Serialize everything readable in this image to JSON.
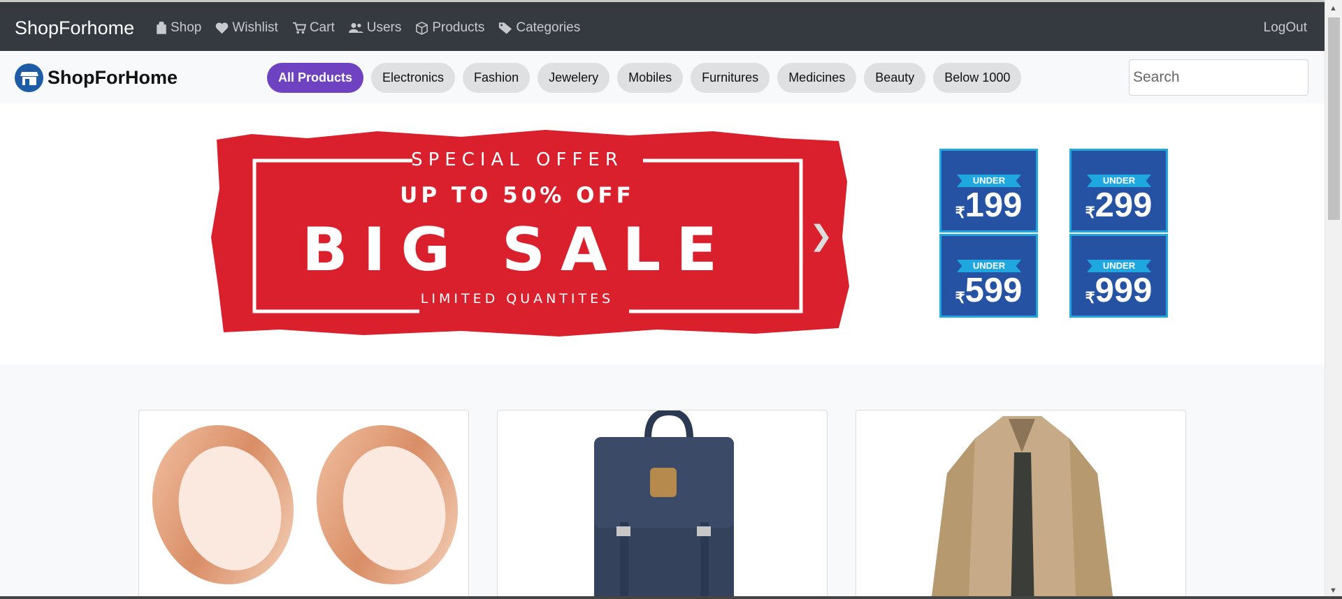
{
  "topbar": {
    "brand": "ShopForhome",
    "nav": [
      {
        "label": "Shop",
        "icon": "shopping-bag-icon"
      },
      {
        "label": "Wishlist",
        "icon": "heart-icon"
      },
      {
        "label": "Cart",
        "icon": "cart-icon"
      },
      {
        "label": "Users",
        "icon": "users-icon"
      },
      {
        "label": "Products",
        "icon": "box-icon"
      },
      {
        "label": "Categories",
        "icon": "tag-icon"
      }
    ],
    "logout": "LogOut"
  },
  "subbar": {
    "logo_text": "ShopForHome",
    "categories": [
      "All Products",
      "Electronics",
      "Fashion",
      "Jewelery",
      "Mobiles",
      "Furnitures",
      "Medicines",
      "Beauty",
      "Below 1000"
    ],
    "active_category": "All Products",
    "search_placeholder": "Search"
  },
  "banner": {
    "special": "SPECIAL OFFER",
    "upto": "UP TO 50% OFF",
    "big": "BIG SALE",
    "limited": "LIMITED QUANTITES",
    "price_tiles": [
      {
        "label": "UNDER",
        "currency": "₹",
        "amount": "199"
      },
      {
        "label": "UNDER",
        "currency": "₹",
        "amount": "299"
      },
      {
        "label": "UNDER",
        "currency": "₹",
        "amount": "599"
      },
      {
        "label": "UNDER",
        "currency": "₹",
        "amount": "999"
      }
    ]
  },
  "products": [
    {
      "image": "rose-gold-ear-tunnels"
    },
    {
      "image": "navy-backpack"
    },
    {
      "image": "khaki-jacket"
    }
  ],
  "colors": {
    "topbar": "#343a40",
    "active_pill": "#6f42c1",
    "sale_red": "#d9202c",
    "tile_blue": "#2552a3"
  }
}
